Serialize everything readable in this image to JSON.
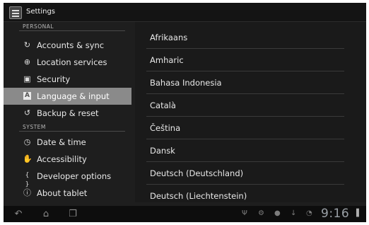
{
  "actionbar": {
    "title": "Settings",
    "icon": "settings-app-icon"
  },
  "sidebar": {
    "sections": [
      {
        "header": "PERSONAL"
      },
      {
        "header": "SYSTEM"
      }
    ],
    "items": [
      {
        "label": "Accounts & sync",
        "icon": "sync-icon",
        "glyph": "↻"
      },
      {
        "label": "Location services",
        "icon": "location-icon",
        "glyph": "⊕"
      },
      {
        "label": "Security",
        "icon": "lock-icon",
        "glyph": "▣"
      },
      {
        "label": "Language & input",
        "icon": "keyboard-icon",
        "glyph": "A",
        "selected": true
      },
      {
        "label": "Backup & reset",
        "icon": "backup-icon",
        "glyph": "↺"
      },
      {
        "label": "Date & time",
        "icon": "clock-icon",
        "glyph": "◷"
      },
      {
        "label": "Accessibility",
        "icon": "hand-icon",
        "glyph": "✋"
      },
      {
        "label": "Developer options",
        "icon": "braces-icon",
        "glyph": "{ }"
      },
      {
        "label": "About tablet",
        "icon": "info-icon",
        "glyph": "ⓘ"
      }
    ]
  },
  "languages": [
    "Afrikaans",
    "Amharic",
    "Bahasa Indonesia",
    "Català",
    "Čeština",
    "Dansk",
    "Deutsch (Deutschland)",
    "Deutsch (Liechtenstein)"
  ],
  "systembar": {
    "back": "↶",
    "home": "⌂",
    "recents": "❐",
    "status_icons": [
      "usb-icon",
      "debug-icon",
      "sd-card-icon",
      "download-icon",
      "wifi-icon"
    ],
    "status_glyphs": [
      "Ψ",
      "⚙",
      "●",
      "↓",
      "◔"
    ],
    "clock": "9:16",
    "battery_glyph": "▌"
  }
}
